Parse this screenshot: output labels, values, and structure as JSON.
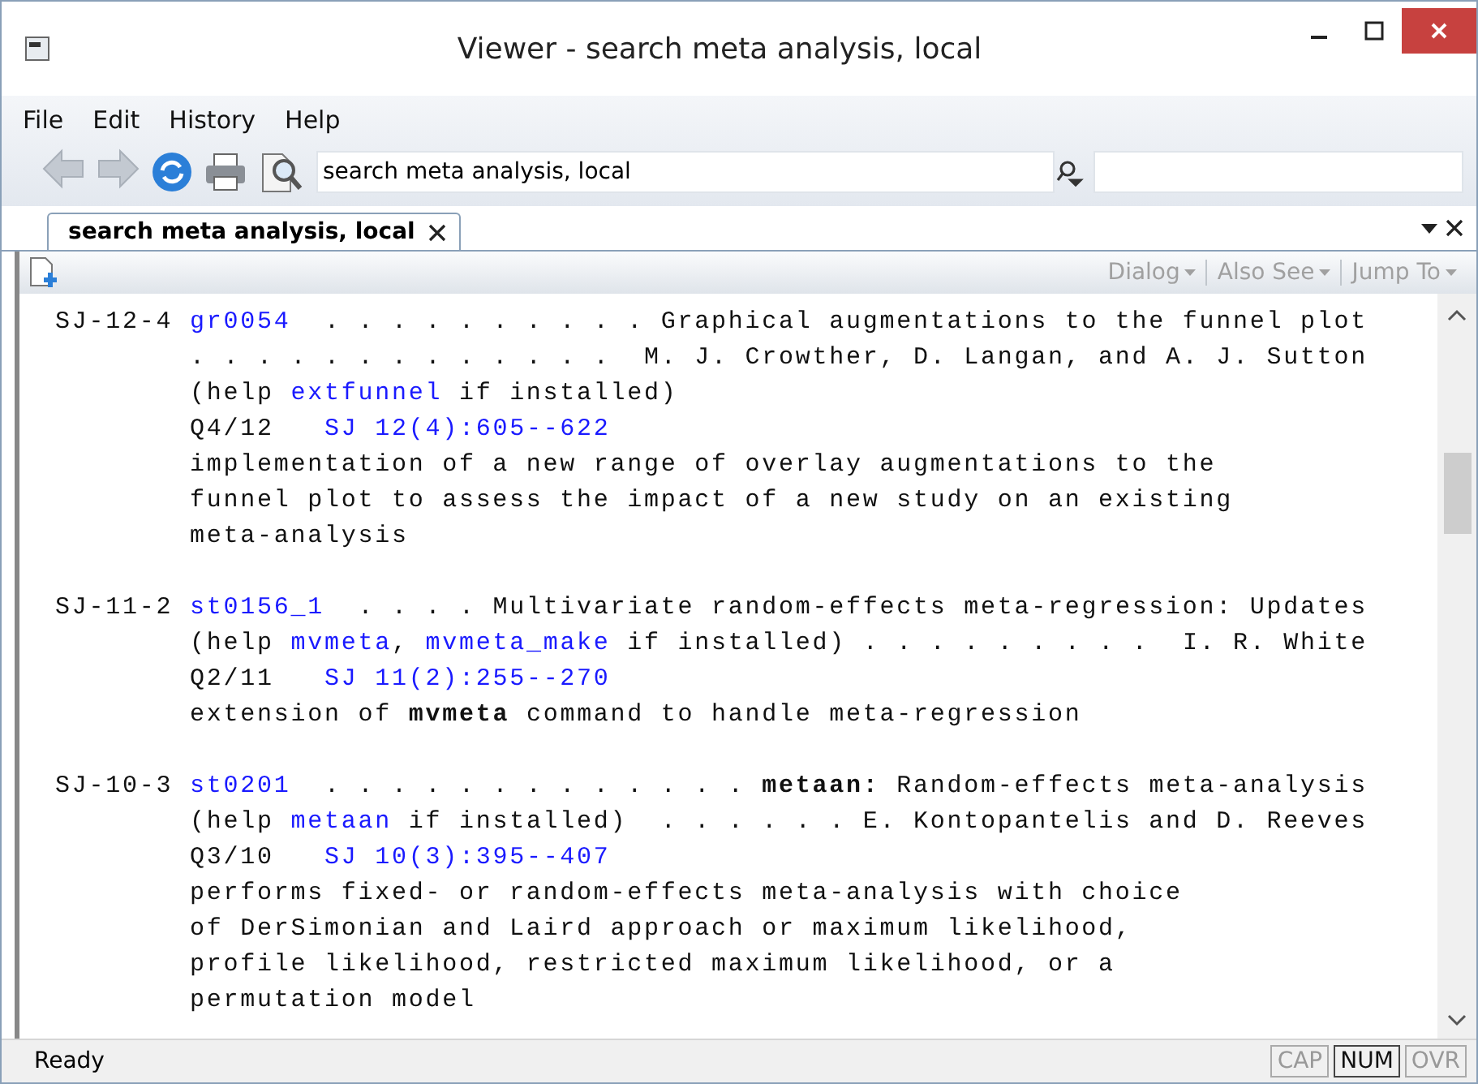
{
  "window": {
    "title": "Viewer - search meta analysis, local"
  },
  "menu": [
    "File",
    "Edit",
    "History",
    "Help"
  ],
  "toolbar": {
    "address": "search meta analysis, local",
    "back_disabled": true,
    "forward_disabled": true
  },
  "tabs": [
    {
      "label": "search meta analysis, local",
      "selected": true
    }
  ],
  "doc_menus": [
    {
      "label": "Dialog",
      "disabled": true
    },
    {
      "label": "Also See",
      "disabled": true
    },
    {
      "label": "Jump To",
      "disabled": true
    }
  ],
  "results": [
    {
      "id": "SJ-12-4",
      "lines": [
        [
          {
            "text": "gr0054",
            "link": true
          },
          {
            "text": "  . . . . . . . . . . Graphical augmentations to the funnel plot",
            "link": false
          }
        ],
        [
          {
            "text": ". . . . . . . . . . . . .  M. J. Crowther, D. Langan, and A. J. Sutton",
            "link": false
          }
        ],
        [
          {
            "text": "(help ",
            "link": false
          },
          {
            "text": "extfunnel",
            "link": true
          },
          {
            "text": " if installed)",
            "link": false
          }
        ],
        [
          {
            "text": "Q4/12   ",
            "link": false
          },
          {
            "text": "SJ 12(4):605--622",
            "link": true
          }
        ],
        [
          {
            "text": "implementation of a new range of overlay augmentations to the",
            "link": false
          }
        ],
        [
          {
            "text": "funnel plot to assess the impact of a new study on an existing",
            "link": false
          }
        ],
        [
          {
            "text": "meta-analysis",
            "link": false
          }
        ]
      ]
    },
    {
      "id": "SJ-11-2",
      "lines": [
        [
          {
            "text": "st0156_1",
            "link": true
          },
          {
            "text": "  . . . . Multivariate random-effects meta-regression: Updates",
            "link": false
          }
        ],
        [
          {
            "text": "(help ",
            "link": false
          },
          {
            "text": "mvmeta",
            "link": true
          },
          {
            "text": ", ",
            "link": false
          },
          {
            "text": "mvmeta_make",
            "link": true
          },
          {
            "text": " if installed) . . . . . . . . .  I. R. White",
            "link": false
          }
        ],
        [
          {
            "text": "Q2/11   ",
            "link": false
          },
          {
            "text": "SJ 11(2):255--270",
            "link": true
          }
        ],
        [
          {
            "text": "extension of **mvmeta** command to handle meta-regression",
            "link": false
          }
        ]
      ]
    },
    {
      "id": "SJ-10-3",
      "lines": [
        [
          {
            "text": "st0201",
            "link": true
          },
          {
            "text": "  . . . . . . . . . . . . . **metaan:** Random-effects meta-analysis",
            "link": false
          }
        ],
        [
          {
            "text": "(help ",
            "link": false
          },
          {
            "text": "metaan",
            "link": true
          },
          {
            "text": " if installed)  . . . . . . E. Kontopantelis and D. Reeves",
            "link": false
          }
        ],
        [
          {
            "text": "Q3/10   ",
            "link": false
          },
          {
            "text": "SJ 10(3):395--407",
            "link": true
          }
        ],
        [
          {
            "text": "performs fixed- or random-effects meta-analysis with choice",
            "link": false
          }
        ],
        [
          {
            "text": "of DerSimonian and Laird approach or maximum likelihood,",
            "link": false
          }
        ],
        [
          {
            "text": "profile likelihood, restricted maximum likelihood, or a",
            "link": false
          }
        ],
        [
          {
            "text": "permutation model",
            "link": false
          }
        ]
      ]
    }
  ],
  "status": {
    "text": "Ready",
    "indicators": [
      {
        "label": "CAP",
        "on": false
      },
      {
        "label": "NUM",
        "on": true
      },
      {
        "label": "OVR",
        "on": false
      }
    ]
  }
}
